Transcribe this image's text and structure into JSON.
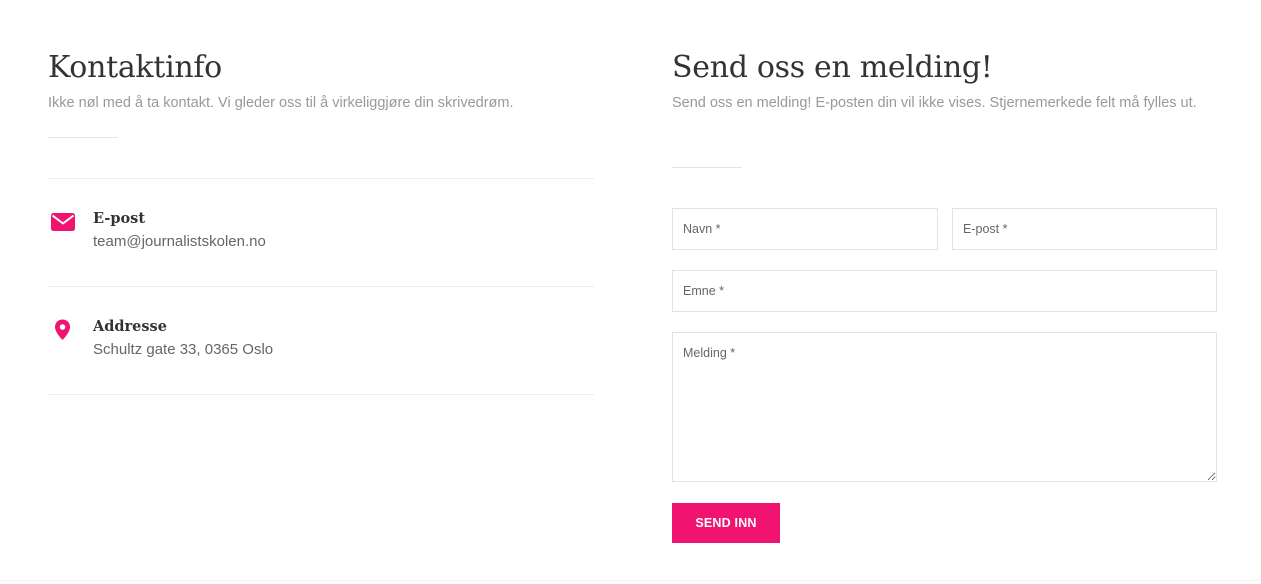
{
  "contact_info": {
    "title": "Kontaktinfo",
    "subtitle": "Ikke nøl med å ta kontakt. Vi gleder oss til å virkeliggjøre din skrivedrøm.",
    "items": [
      {
        "icon": "envelope-icon",
        "label": "E-post",
        "value": "team@journalistskolen.no"
      },
      {
        "icon": "map-pin-icon",
        "label": "Addresse",
        "value": "Schultz gate 33, 0365 Oslo"
      }
    ]
  },
  "form": {
    "title": "Send oss en melding!",
    "subtitle": "Send oss en melding! E-posten din vil ikke vises. Stjernemerkede felt må fylles ut.",
    "fields": {
      "name": {
        "placeholder": "Navn *",
        "value": ""
      },
      "email": {
        "placeholder": "E-post *",
        "value": ""
      },
      "subject": {
        "placeholder": "Emne *",
        "value": ""
      },
      "message": {
        "placeholder": "Melding *",
        "value": ""
      }
    },
    "submit_label": "SEND INN"
  },
  "colors": {
    "accent": "#f0136f",
    "heading": "#333333",
    "muted_text": "#999999",
    "border": "#e2e2e2"
  }
}
